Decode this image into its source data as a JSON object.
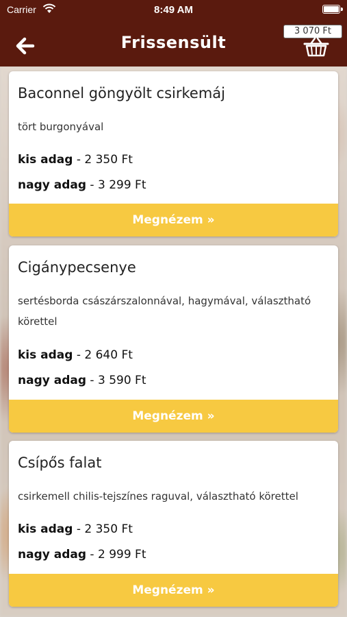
{
  "status_bar": {
    "carrier": "Carrier",
    "time": "8:49 AM"
  },
  "header": {
    "title": "Frissensült",
    "cart_total": "3 070 Ft"
  },
  "colors": {
    "header_bg": "#5a1a0e",
    "button_bg": "#f7c941"
  },
  "items": [
    {
      "name": "Baconnel göngyölt csirkemáj",
      "description": "tört burgonyával",
      "prices": [
        {
          "size": "kis adag",
          "price": " - 2 350 Ft"
        },
        {
          "size": "nagy adag",
          "price": " - 3 299 Ft"
        }
      ],
      "button": "Megnézem »"
    },
    {
      "name": "Cigánypecsenye",
      "description": "sertésborda császárszalonnával, hagymával, választható körettel",
      "prices": [
        {
          "size": "kis adag",
          "price": " - 2 640 Ft"
        },
        {
          "size": "nagy adag",
          "price": " - 3 590 Ft"
        }
      ],
      "button": "Megnézem »"
    },
    {
      "name": "Csípős falat",
      "description": "csirkemell chilis-tejszínes raguval, választható körettel",
      "prices": [
        {
          "size": "kis adag",
          "price": " - 2 350 Ft"
        },
        {
          "size": "nagy adag",
          "price": " - 2 999 Ft"
        }
      ],
      "button": "Megnézem »"
    }
  ]
}
